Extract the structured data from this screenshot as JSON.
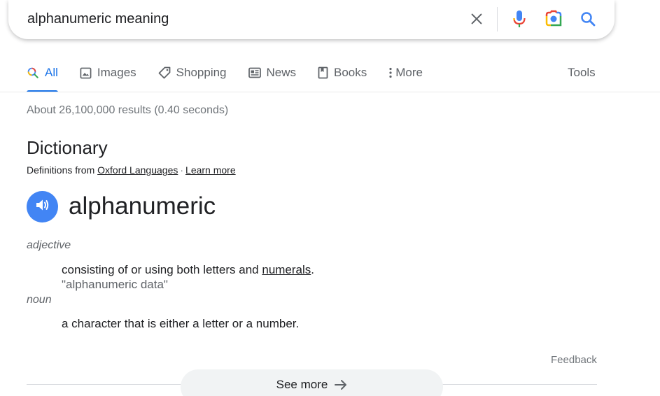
{
  "search": {
    "query": "alphanumeric meaning",
    "icons": [
      "close-icon",
      "microphone-icon",
      "google-lens-icon",
      "search-icon"
    ]
  },
  "tabs": [
    {
      "label": "All",
      "icon": "search-icon",
      "active": true
    },
    {
      "label": "Images",
      "icon": "image-icon"
    },
    {
      "label": "Shopping",
      "icon": "tag-icon"
    },
    {
      "label": "News",
      "icon": "news-icon"
    },
    {
      "label": "Books",
      "icon": "book-icon"
    },
    {
      "label": "More",
      "icon": "more-vert-icon"
    }
  ],
  "tools_label": "Tools",
  "result_stats": "About 26,100,000 results (0.40 seconds)",
  "dictionary": {
    "title": "Dictionary",
    "source_prefix": "Definitions from",
    "source_name": "Oxford Languages",
    "separator": "·",
    "learn_more": "Learn more",
    "word": "alphanumeric",
    "entries": [
      {
        "pos": "adjective",
        "definition_text": "consisting of or using both letters and",
        "definition_link": "numerals",
        "definition_end": ".",
        "example": "\"alphanumeric data\""
      },
      {
        "pos": "noun",
        "definition_text": "a character that is either a letter or a number."
      }
    ]
  },
  "feedback_label": "Feedback",
  "see_more_label": "See more",
  "colors": {
    "accent": "#1a73e8",
    "speaker": "#4285f4",
    "text": "#202124",
    "muted": "#70757a"
  }
}
